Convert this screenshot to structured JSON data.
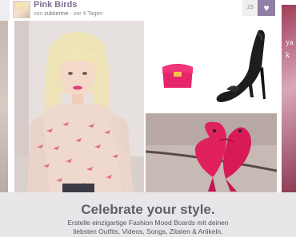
{
  "board": {
    "title": "Pink Birds",
    "byline_prefix": "von",
    "author": "zukkerme",
    "age": "· vor 4 Tagen",
    "like_count": "23",
    "like_icon": "heart-icon"
  },
  "right_card_text": "ya\nk",
  "banner": {
    "title": "Celebrate your style.",
    "line1": "Erstelle einzigartige Fashion Mood Boards mit deinen",
    "line2": "liebsten Outfits, Videos, Songs, Zitaten & Artikeln."
  },
  "colors": {
    "accent": "#8e7fa5",
    "title": "#7d6f8e",
    "banner_bg": "#e9e6ea"
  }
}
